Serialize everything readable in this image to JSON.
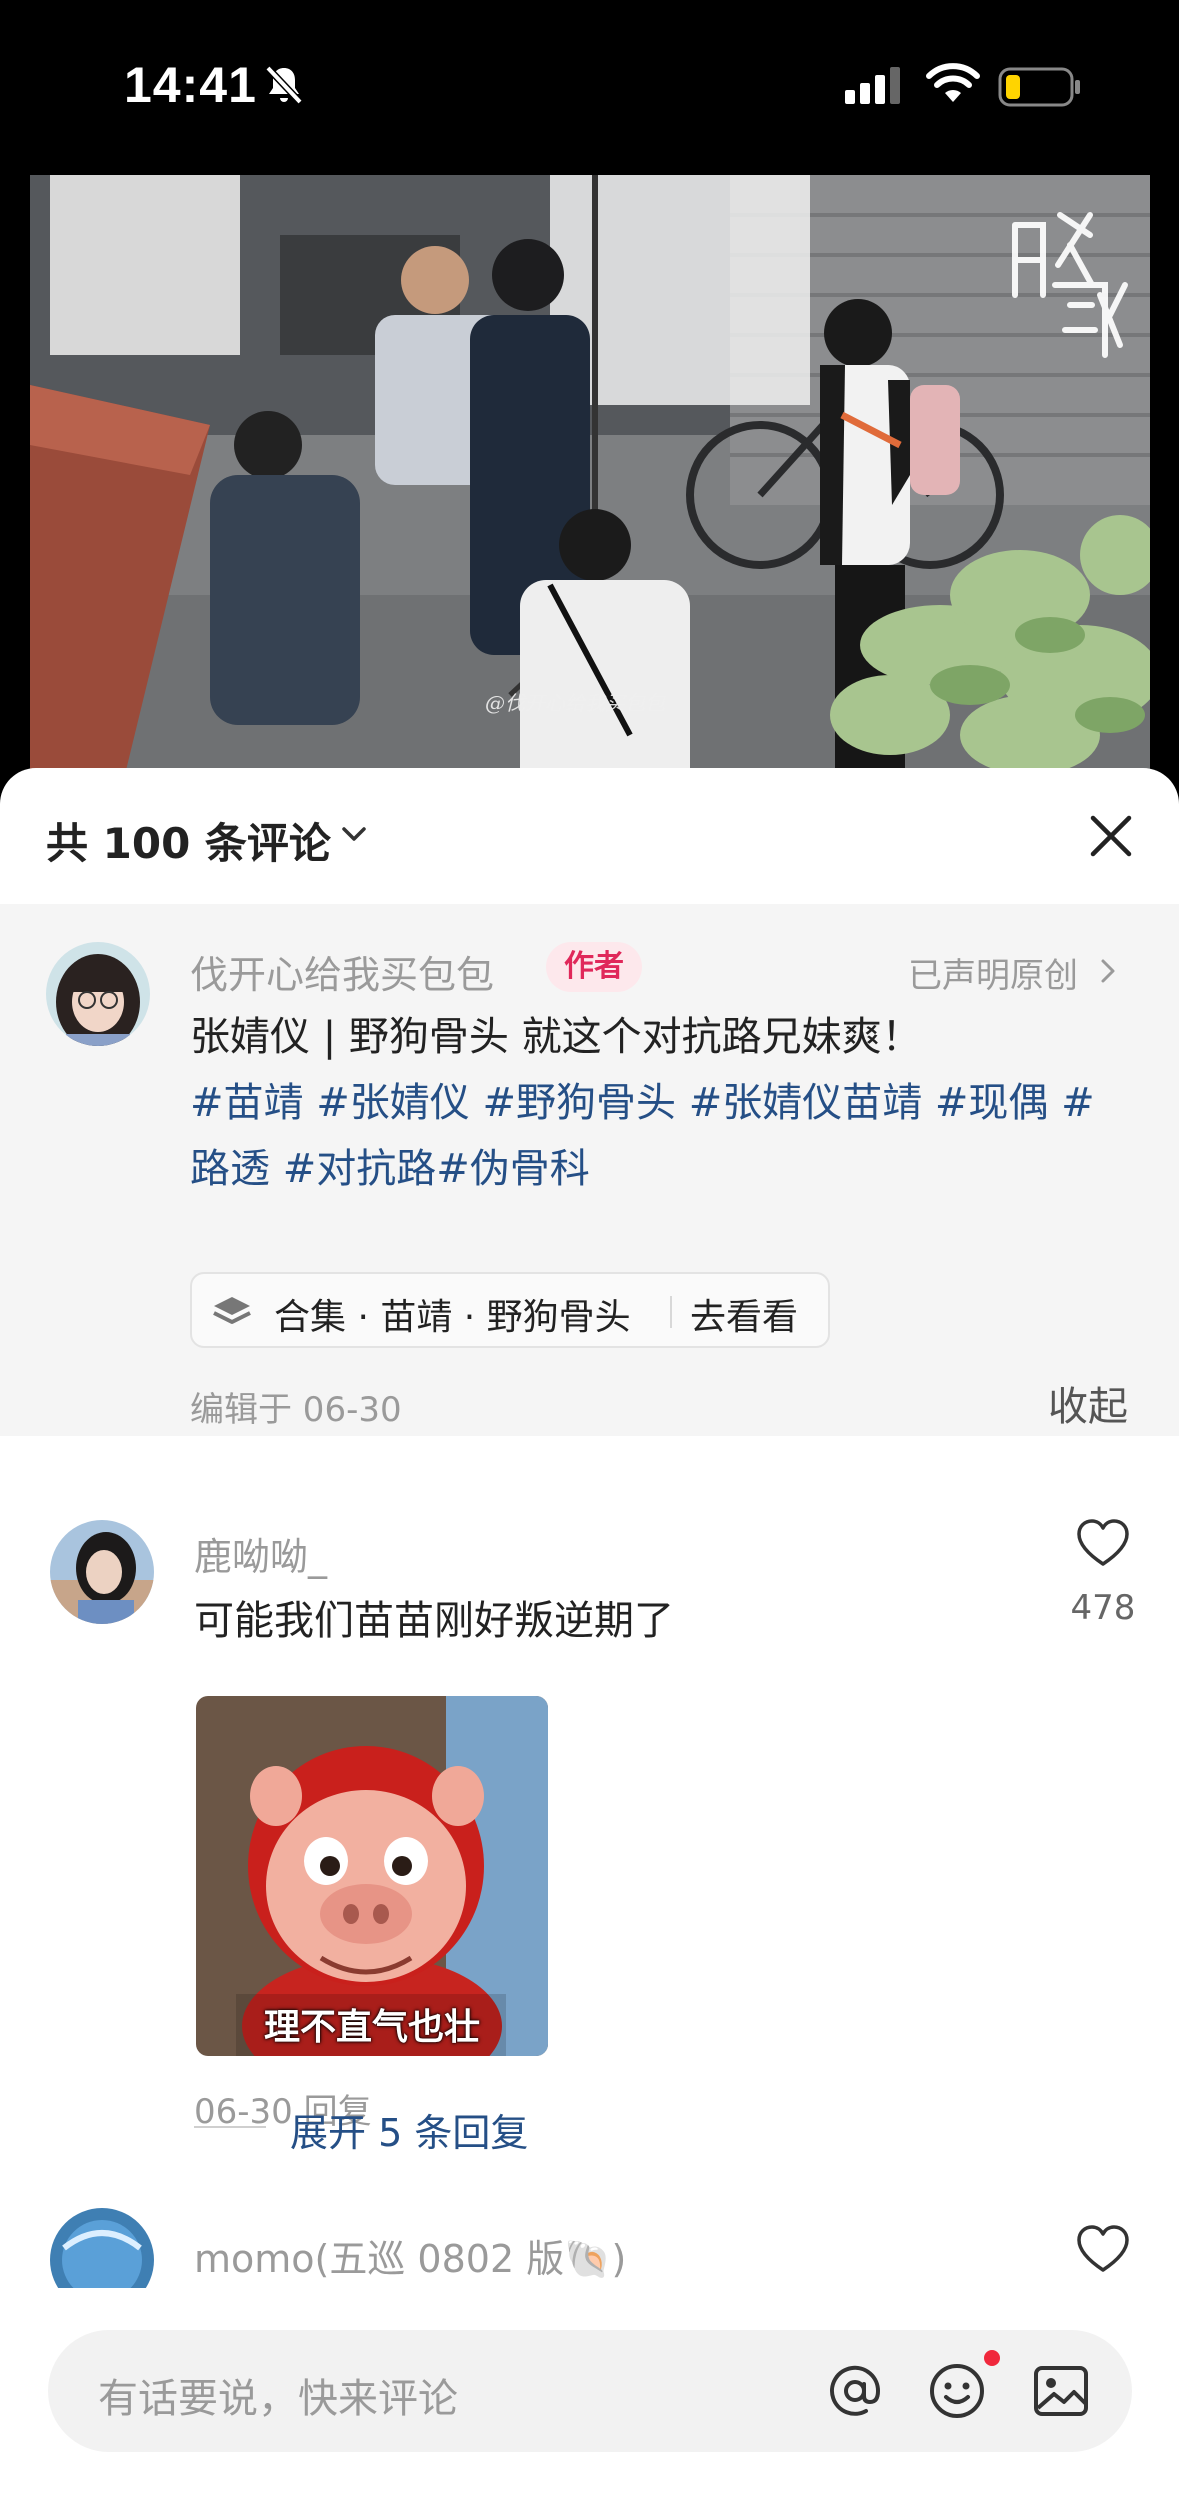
{
  "status_bar": {
    "time": "14:41"
  },
  "photo": {
    "watermark": "@伐开心给我买包包"
  },
  "sheet": {
    "comment_count_label": "共 100 条评论"
  },
  "post": {
    "author": "伐开心给我买包包",
    "author_badge": "作者",
    "original_label": "已声明原创",
    "title": "张婧仪 | 野狗骨头 就这个对抗路兄妹爽！",
    "tags": "#苗靖 #张婧仪 #野狗骨头 #张婧仪苗靖 #现偶 #路透 #对抗路#伪骨科",
    "collection_label": "合集 · 苗靖 · 野狗骨头",
    "collection_action": "去看看",
    "edited": "编辑于  06-30",
    "collapse_label": "收起"
  },
  "comments": [
    {
      "name": "鹿呦呦_",
      "text": "可能我们苗苗刚好叛逆期了",
      "likes": "478",
      "sticker_caption": "理不直气也壮",
      "meta": "06-30 回复",
      "expand_label": "展开 5 条回复"
    },
    {
      "name": "momo(五巡 0802 版🐚)"
    }
  ],
  "composer": {
    "placeholder": "有话要说，快来评论"
  }
}
